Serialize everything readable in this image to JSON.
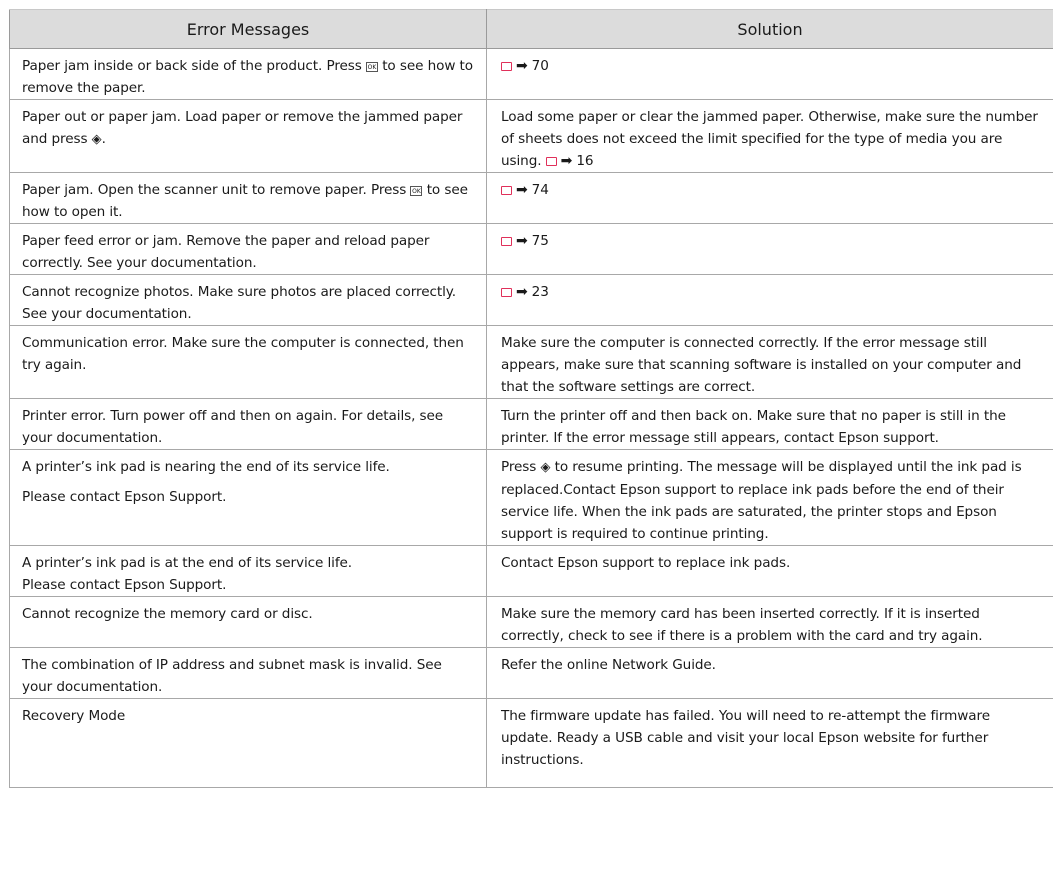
{
  "table": {
    "headers": {
      "error": "Error Messages",
      "solution": "Solution"
    },
    "rows": [
      {
        "error_a": "Paper jam inside or back side of the product. Press ",
        "error_b": " to see how to remove the paper.",
        "error_icon": "ok-button-icon",
        "ref_page": "70"
      },
      {
        "error_a": "Paper out or paper jam. Load paper or remove the jammed paper and press ",
        "error_b": ".",
        "error_icon": "start-button-icon",
        "solution": "Load some paper or clear the jammed paper. Otherwise, make sure the number of sheets does not  exceed the limit specified for the type of media you are using. ",
        "ref_page": "16"
      },
      {
        "error_a": "Paper jam. Open the scanner unit to remove paper. Press ",
        "error_b": " to see how to open it.",
        "error_icon": "ok-button-icon",
        "ref_page": "74"
      },
      {
        "error": "Paper feed error or jam. Remove the paper and reload paper correctly. See your documentation.",
        "ref_page": "75"
      },
      {
        "error": "Cannot recognize photos. Make sure photos are placed correctly. See your documentation.",
        "ref_page": "23"
      },
      {
        "error": "Communication error. Make sure the computer is connected, then try again.",
        "solution": "Make sure the computer is connected correctly. If the error message still appears, make sure that scanning software is installed on your computer and that the software settings are correct."
      },
      {
        "error": "Printer error. Turn power off and then on again. For details, see your documentation.",
        "solution": "Turn the printer off and then back on. Make sure that no paper is still in the printer. If the error message still appears, contact Epson support."
      },
      {
        "error": "A printer’s ink pad is nearing the end of its service life.",
        "error_2": "Please contact Epson Support.",
        "solution_a": "Press ",
        "solution_icon": "start-button-icon",
        "solution_b": " to resume printing. The message will be displayed until the ink pad is replaced.Contact Epson support to replace ink pads before the end of their service life. When the ink pads are saturated, the printer stops and Epson support is required to continue printing."
      },
      {
        "error": "A printer’s ink pad is at the end of its service life.",
        "error_2": "Please contact Epson Support.",
        "solution": "Contact Epson support to replace ink pads."
      },
      {
        "error": "Cannot recognize the memory card or disc.",
        "solution": "Make sure the memory card has been inserted correctly. If it is inserted correctly, check to see if there is a problem with the card and try again."
      },
      {
        "error": "The combination of IP address and subnet mask is invalid. See your documentation.",
        "solution": "Refer the online Network Guide."
      },
      {
        "error": "Recovery Mode",
        "solution": "The firmware update has failed. You will need to re-attempt the firmware update. Ready a USB cable and visit your local Epson website for further instructions."
      }
    ]
  },
  "icons": {
    "book": "book-icon",
    "arrow": "right-arrow-icon",
    "ok": "ok-button-icon",
    "start": "start-button-icon",
    "ok_text": "OK",
    "arrow_glyph": "➡",
    "start_glyph": "◈"
  },
  "colors": {
    "header_bg": "#dcdcdc",
    "book_icon": "#e0305a",
    "border": "#a8a8a8"
  }
}
